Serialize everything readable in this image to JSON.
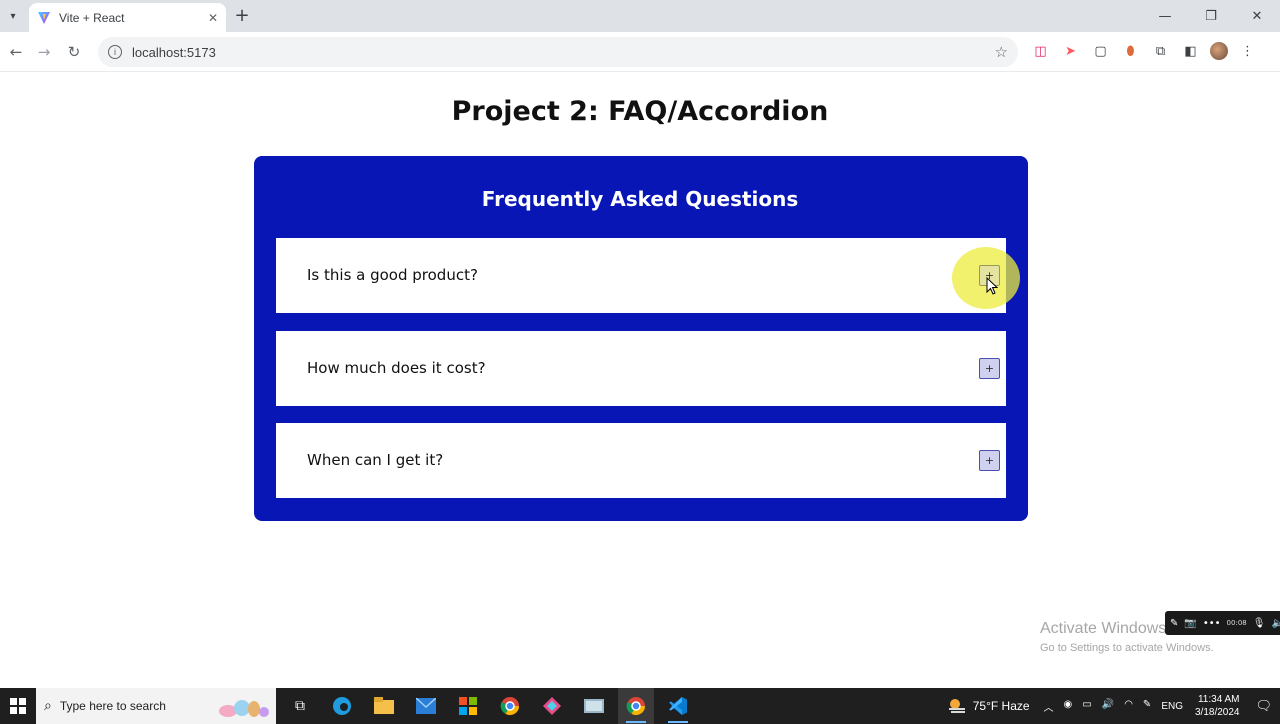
{
  "browser": {
    "tab_title": "Vite + React",
    "url": "localhost:5173",
    "new_tab_label": "+",
    "tab_close": "✕"
  },
  "page": {
    "title": "Project 2: FAQ/Accordion"
  },
  "faq": {
    "heading": "Frequently Asked Questions",
    "accent_color": "#0716b5",
    "items": [
      {
        "question": "Is this a good product?",
        "toggle": "+"
      },
      {
        "question": "How much does it cost?",
        "toggle": "+"
      },
      {
        "question": "When can I get it?",
        "toggle": "+"
      }
    ]
  },
  "watermark": {
    "line1": "Activate Windows",
    "line2": "Go to Settings to activate Windows."
  },
  "recorder": {
    "time": "00:08"
  },
  "taskbar": {
    "search_placeholder": "Type here to search",
    "weather": "75°F  Haze",
    "language": "ENG",
    "time": "11:34 AM",
    "date": "3/18/2024"
  }
}
